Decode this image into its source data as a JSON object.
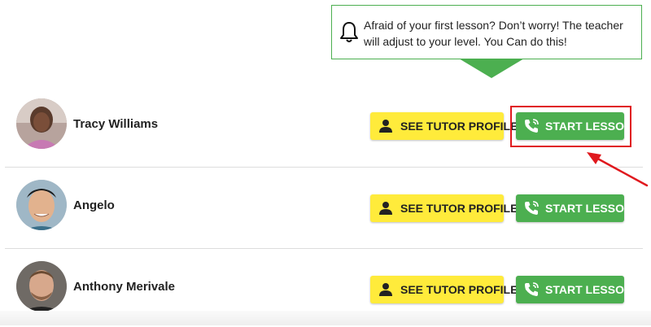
{
  "tooltip": {
    "message": "Afraid of your first lesson? Don’t worry! The teacher will adjust to your level. You Can do this!",
    "icon": "bell-icon",
    "border_color": "#4caf50"
  },
  "tutors": [
    {
      "name": "Tracy Williams",
      "profile_label": "SEE TUTOR PROFILE",
      "lesson_label": "START LESSON",
      "highlighted": true
    },
    {
      "name": "Angelo",
      "profile_label": "SEE TUTOR PROFILE",
      "lesson_label": "START LESSON",
      "highlighted": false
    },
    {
      "name": "Anthony Merivale",
      "profile_label": "SEE TUTOR PROFILE",
      "lesson_label": "START LESSON",
      "highlighted": false
    }
  ],
  "colors": {
    "profile_button": "#ffeb3b",
    "lesson_button": "#4caf50",
    "highlight": "#e0191e"
  },
  "icons": {
    "profile": "person-icon",
    "lesson": "phone-icon",
    "annotation": "red-arrow-icon"
  }
}
